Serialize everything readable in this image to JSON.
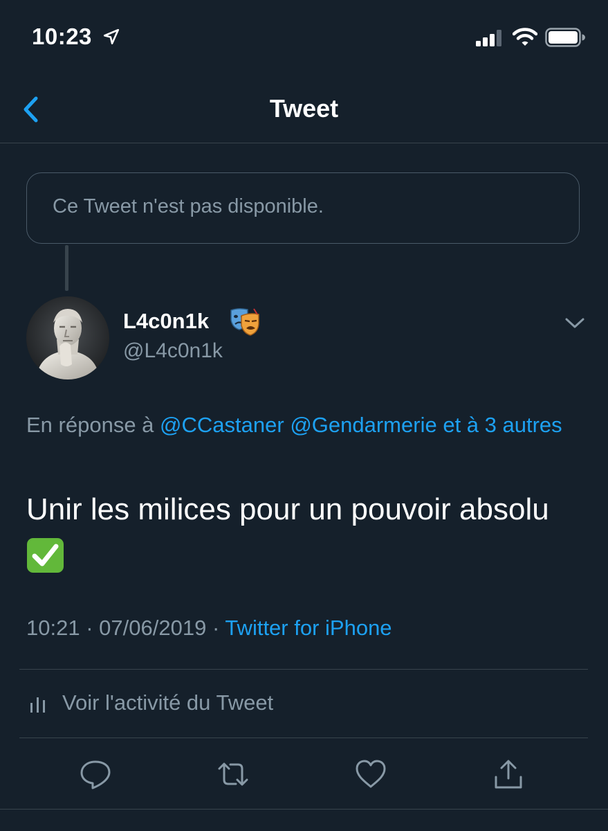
{
  "status_bar": {
    "time": "10:23",
    "icons": [
      "location-arrow-icon",
      "signal-icon",
      "wifi-icon",
      "battery-icon"
    ]
  },
  "nav": {
    "title": "Tweet",
    "back_icon": "chevron-left-icon"
  },
  "quoted": {
    "unavailable_text": "Ce Tweet n'est pas disponible."
  },
  "tweet": {
    "display_name": "L4c0n1k",
    "name_emoji": "performing-arts-masks-icon",
    "handle": "@L4c0n1k",
    "reply_prefix": "En réponse à ",
    "reply_mention_1": "@CCastaner",
    "reply_mention_2": "@Gendarmerie",
    "reply_suffix": "et à 3 autres",
    "text": "Unir les milices pour un pouvoir absolu",
    "text_emoji": "check-mark-button-icon",
    "time": "10:21",
    "separator": "·",
    "date": "07/06/2019",
    "source": "Twitter for iPhone"
  },
  "activity": {
    "label": "Voir l'activité du Tweet",
    "icon": "bar-chart-icon"
  },
  "actions": [
    "reply-icon",
    "retweet-icon",
    "like-icon",
    "share-icon"
  ],
  "colors": {
    "background": "#15202b",
    "accent": "#1da1f2",
    "secondary_text": "#8899a6",
    "divider": "#38444d"
  }
}
